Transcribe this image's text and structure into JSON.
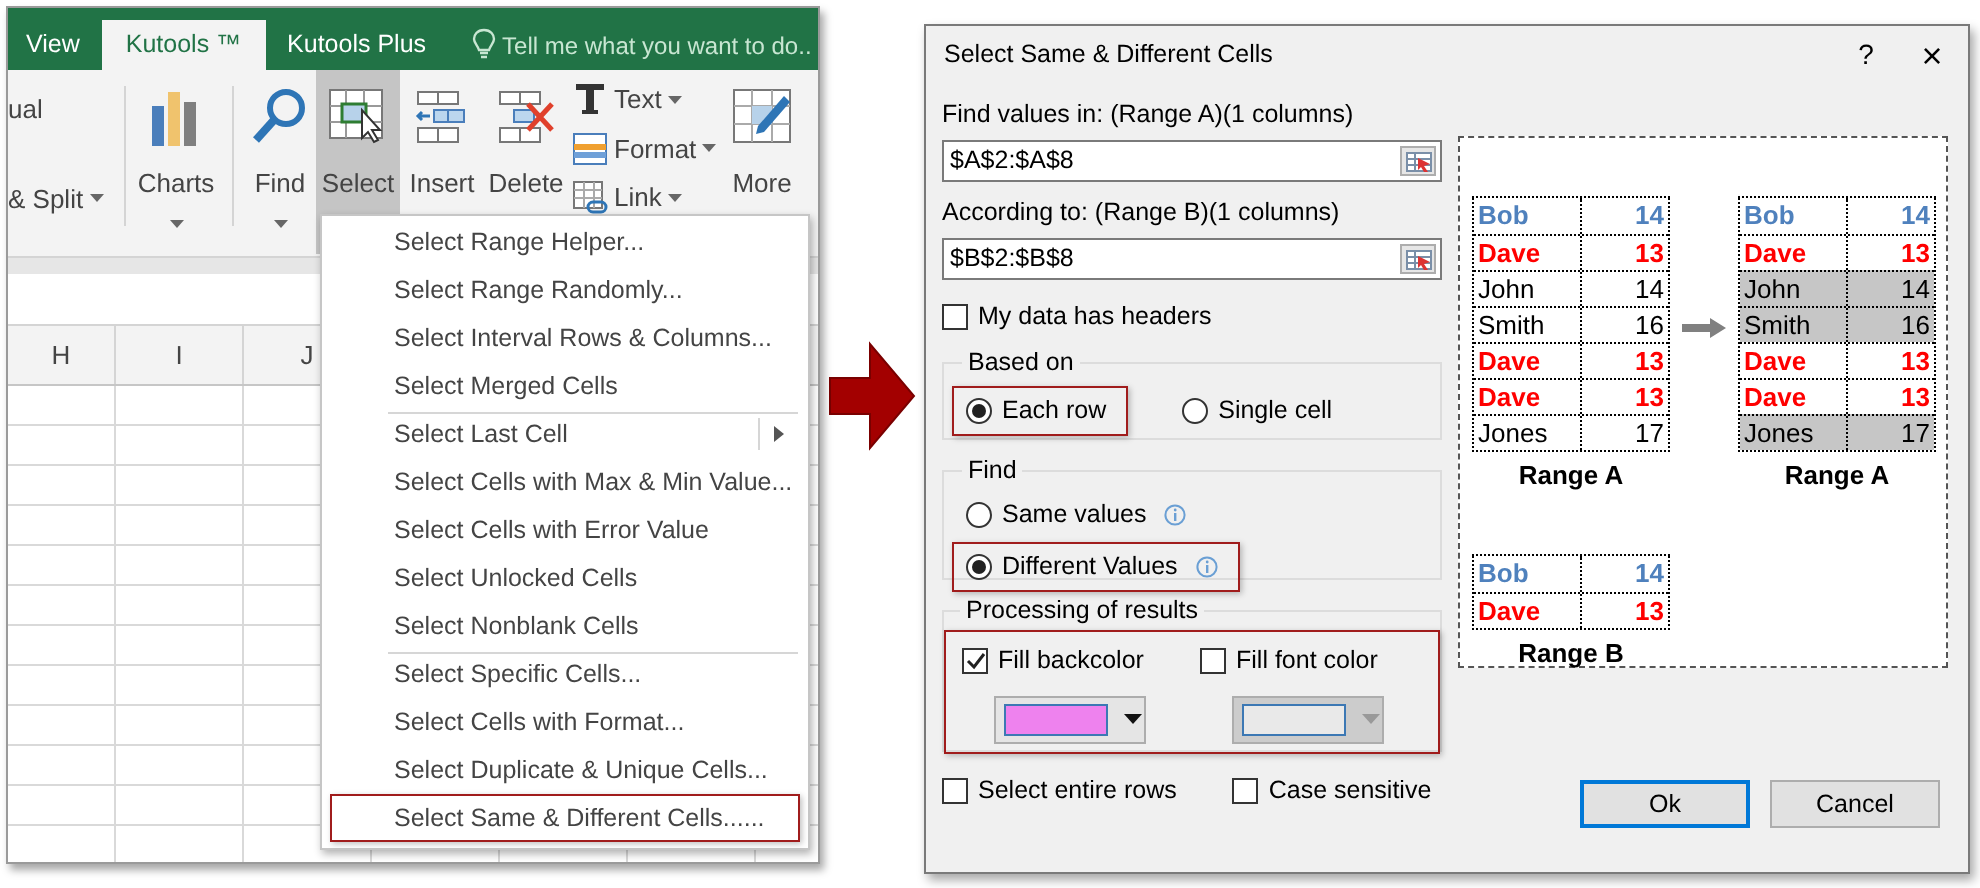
{
  "excel": {
    "tabs": [
      {
        "label": "View",
        "selected": false
      },
      {
        "label": "Kutools ™",
        "selected": true
      },
      {
        "label": "Kutools Plus",
        "selected": false
      }
    ],
    "tell_me": "Tell me what you want to do..",
    "partial_group": {
      "top": "ual",
      "bottom": "& Split"
    },
    "ribbon": [
      {
        "kind": "charts",
        "label": "Charts",
        "selected": false
      },
      {
        "kind": "find",
        "label": "Find",
        "selected": false
      },
      {
        "kind": "select",
        "label": "Select",
        "selected": true
      },
      {
        "kind": "insert",
        "label": "Insert",
        "selected": false
      },
      {
        "kind": "delete",
        "label": "Delete",
        "selected": false
      },
      {
        "kind": "stack",
        "items": [
          {
            "kind": "text",
            "label": "Text"
          },
          {
            "kind": "format",
            "label": "Format"
          },
          {
            "kind": "link",
            "label": "Link"
          }
        ]
      },
      {
        "kind": "more",
        "label": "More",
        "selected": false
      }
    ],
    "column_headers": [
      "H",
      "I",
      "J"
    ],
    "menu": [
      {
        "label": "Select Range Helper...",
        "separator_before": false,
        "submenu": false,
        "highlighted": false
      },
      {
        "label": "Select Range Randomly...",
        "separator_before": false,
        "submenu": false,
        "highlighted": false
      },
      {
        "label": "Select Interval Rows & Columns...",
        "separator_before": false,
        "submenu": false,
        "highlighted": false
      },
      {
        "label": "Select Merged Cells",
        "separator_before": false,
        "submenu": false,
        "highlighted": false
      },
      {
        "label": "Select Last Cell",
        "separator_before": true,
        "submenu": true,
        "highlighted": false
      },
      {
        "label": "Select Cells with Max & Min Value...",
        "separator_before": false,
        "submenu": false,
        "highlighted": false
      },
      {
        "label": "Select Cells with Error Value",
        "separator_before": false,
        "submenu": false,
        "highlighted": false
      },
      {
        "label": "Select Unlocked Cells",
        "separator_before": false,
        "submenu": false,
        "highlighted": false
      },
      {
        "label": "Select Nonblank Cells",
        "separator_before": false,
        "submenu": false,
        "highlighted": false
      },
      {
        "label": "Select Specific Cells...",
        "separator_before": true,
        "submenu": false,
        "highlighted": false
      },
      {
        "label": "Select Cells with Format...",
        "separator_before": false,
        "submenu": false,
        "highlighted": false
      },
      {
        "label": "Select Duplicate & Unique Cells...",
        "separator_before": false,
        "submenu": false,
        "highlighted": false
      },
      {
        "label": "Select Same & Different Cells......",
        "separator_before": false,
        "submenu": false,
        "highlighted": true
      }
    ]
  },
  "dialog": {
    "title": "Select Same & Different Cells",
    "help": "?",
    "close": "×",
    "range_a": {
      "label": "Find values in: (Range A)(1 columns)",
      "value": "$A$2:$A$8"
    },
    "range_b": {
      "label": "According to: (Range B)(1 columns)",
      "value": "$B$2:$B$8"
    },
    "has_headers": {
      "label": "My data has headers",
      "checked": false
    },
    "based_on": {
      "title": "Based on",
      "options": [
        {
          "label": "Each row",
          "selected": true,
          "highlighted": true,
          "info": false
        },
        {
          "label": "Single cell",
          "selected": false,
          "highlighted": false,
          "info": false
        }
      ]
    },
    "find": {
      "title": "Find",
      "options": [
        {
          "label": "Same values",
          "selected": false,
          "highlighted": false,
          "info": true
        },
        {
          "label": "Different Values",
          "selected": true,
          "highlighted": true,
          "info": true
        }
      ]
    },
    "processing": {
      "title": "Processing of results",
      "highlighted": true,
      "options": [
        {
          "label": "Fill backcolor",
          "checked": true,
          "color": "#ee82ee",
          "disabled": false
        },
        {
          "label": "Fill font color",
          "checked": false,
          "color": "#e9e9e9",
          "disabled": true
        }
      ]
    },
    "bottom_options": [
      {
        "label": "Select entire rows",
        "checked": false
      },
      {
        "label": "Case sensitive",
        "checked": false
      }
    ],
    "preview": {
      "source": {
        "caption": "Range A",
        "rows": [
          {
            "name": "Bob",
            "value": "14",
            "color": "#4f81bd",
            "bold": true,
            "shaded": false
          },
          {
            "name": "Dave",
            "value": "13",
            "color": "#ff0000",
            "bold": true,
            "shaded": false
          },
          {
            "name": "John",
            "value": "14",
            "color": "#000000",
            "bold": false,
            "shaded": false
          },
          {
            "name": "Smith",
            "value": "16",
            "color": "#000000",
            "bold": false,
            "shaded": false
          },
          {
            "name": "Dave",
            "value": "13",
            "color": "#ff0000",
            "bold": true,
            "shaded": false
          },
          {
            "name": "Dave",
            "value": "13",
            "color": "#ff0000",
            "bold": true,
            "shaded": false
          },
          {
            "name": "Jones",
            "value": "17",
            "color": "#000000",
            "bold": false,
            "shaded": false
          }
        ]
      },
      "compare": {
        "caption": "Range B",
        "rows": [
          {
            "name": "Bob",
            "value": "14",
            "color": "#4f81bd",
            "bold": true,
            "shaded": false
          },
          {
            "name": "Dave",
            "value": "13",
            "color": "#ff0000",
            "bold": true,
            "shaded": false
          }
        ]
      },
      "result": {
        "caption": "Range A",
        "rows": [
          {
            "name": "Bob",
            "value": "14",
            "color": "#4f81bd",
            "bold": true,
            "shaded": false
          },
          {
            "name": "Dave",
            "value": "13",
            "color": "#ff0000",
            "bold": true,
            "shaded": false
          },
          {
            "name": "John",
            "value": "14",
            "color": "#000000",
            "bold": false,
            "shaded": true
          },
          {
            "name": "Smith",
            "value": "16",
            "color": "#000000",
            "bold": false,
            "shaded": true
          },
          {
            "name": "Dave",
            "value": "13",
            "color": "#ff0000",
            "bold": true,
            "shaded": false
          },
          {
            "name": "Dave",
            "value": "13",
            "color": "#ff0000",
            "bold": true,
            "shaded": false
          },
          {
            "name": "Jones",
            "value": "17",
            "color": "#000000",
            "bold": false,
            "shaded": true
          }
        ]
      }
    },
    "buttons": [
      {
        "label": "Ok",
        "focused": true
      },
      {
        "label": "Cancel",
        "focused": false
      }
    ]
  }
}
